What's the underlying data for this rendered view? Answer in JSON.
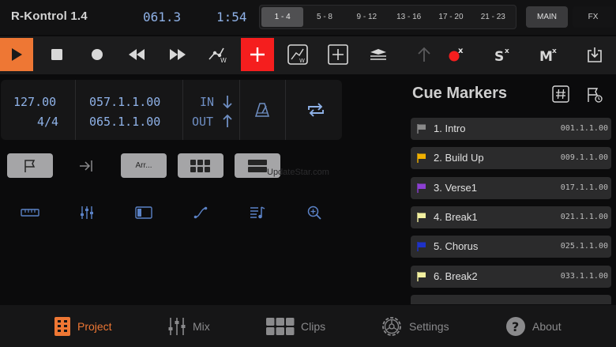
{
  "app": {
    "title": "R-Kontrol 1.4",
    "song_position": "061.3",
    "time": "1:54"
  },
  "banks": [
    {
      "label": "1 - 4",
      "active": true
    },
    {
      "label": "5 - 8",
      "active": false
    },
    {
      "label": "9 - 12",
      "active": false
    },
    {
      "label": "13 - 16",
      "active": false
    },
    {
      "label": "17 - 20",
      "active": false
    },
    {
      "label": "21 - 23",
      "active": false
    }
  ],
  "views": {
    "main_label": "MAIN",
    "fx_label": "FX"
  },
  "transport": {
    "icons": [
      "play-icon",
      "stop-icon",
      "record-icon",
      "rewind-icon",
      "fast-forward-icon",
      "automation-write-icon",
      "add-icon",
      "automation-write-box-icon",
      "add-marker-icon",
      "layers-icon",
      "up-arrow-icon",
      "clear-record-icon",
      "clear-solo-icon",
      "clear-mute-icon",
      "save-icon"
    ],
    "colors": {
      "play": "#ee7734",
      "add": "#f51e1e",
      "record_dot": "#f51e1e"
    }
  },
  "info": {
    "tempo": "127.00",
    "signature": "4/4",
    "locator_left": "057.1.1.00",
    "locator_right": "065.1.1.00",
    "in_label": "IN",
    "out_label": "OUT"
  },
  "buttons": {
    "arrange_label": "Arr..."
  },
  "cue_markers": {
    "title": "Cue Markers",
    "items": [
      {
        "name": "1. Intro",
        "position": "001.1.1.00",
        "color": "#8a8a8a"
      },
      {
        "name": "2. Build Up",
        "position": "009.1.1.00",
        "color": "#f0b000"
      },
      {
        "name": "3. Verse1",
        "position": "017.1.1.00",
        "color": "#8c3fd2"
      },
      {
        "name": "4. Break1",
        "position": "021.1.1.00",
        "color": "#f2f0a0"
      },
      {
        "name": "5. Chorus",
        "position": "025.1.1.00",
        "color": "#1e32c8"
      },
      {
        "name": "6. Break2",
        "position": "033.1.1.00",
        "color": "#f2f0a0"
      }
    ]
  },
  "nav": [
    {
      "label": "Project",
      "icon": "project-icon",
      "active": true
    },
    {
      "label": "Mix",
      "icon": "mix-icon",
      "active": false
    },
    {
      "label": "Clips",
      "icon": "clips-icon",
      "active": false
    },
    {
      "label": "Settings",
      "icon": "settings-icon",
      "active": false
    },
    {
      "label": "About",
      "icon": "about-icon",
      "active": false
    }
  ],
  "watermark": "UpdateStar.com"
}
